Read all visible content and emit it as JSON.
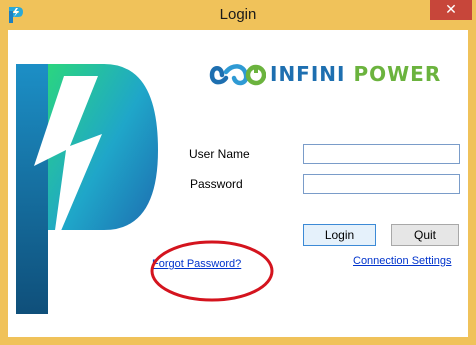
{
  "window": {
    "title": "Login",
    "close_symbol": "✕",
    "app_icon": "infini-power-p-icon"
  },
  "brand": {
    "word1": "INFINI",
    "word2": "POWER",
    "logo_icon": "infinity-loop-icon"
  },
  "form": {
    "username_label": "User Name",
    "username_value": "",
    "password_label": "Password",
    "password_value": ""
  },
  "buttons": {
    "login": "Login",
    "quit": "Quit"
  },
  "links": {
    "forgot_password": "Forgot Password?",
    "connection_settings": "Connection Settings"
  },
  "colors": {
    "titlebar": "#f0c25a",
    "close_button": "#c7463a",
    "brand_blue": "#1e6fb0",
    "brand_green": "#6bb33e",
    "annotation": "#d4141e"
  }
}
